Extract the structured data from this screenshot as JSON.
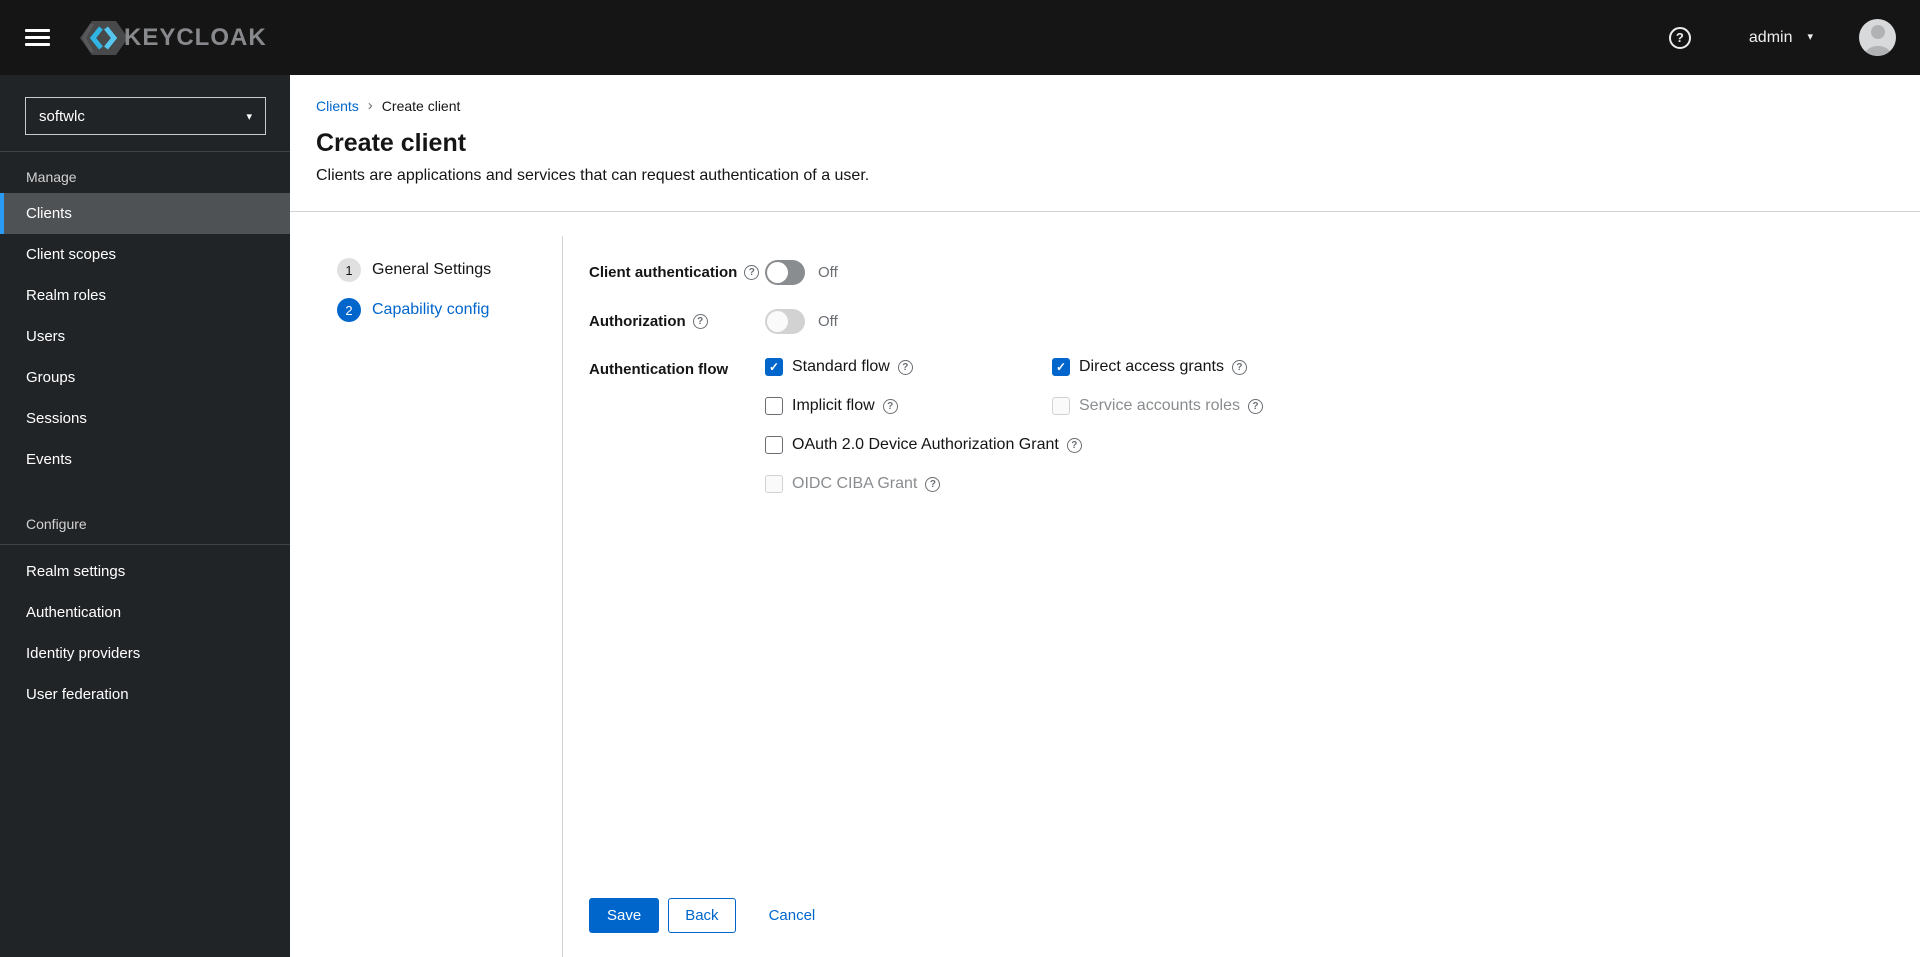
{
  "masthead": {
    "brand_text": "KEYCLOAK",
    "user_name": "admin"
  },
  "icons": {
    "help_glyph": "?",
    "caret_glyph": "▾",
    "check_glyph": "✓",
    "breadcrumb_sep": "›"
  },
  "sidebar": {
    "realm_selector": {
      "value": "softwlc"
    },
    "sections": [
      {
        "title": "Manage",
        "items": [
          {
            "label": "Clients",
            "current": true
          },
          {
            "label": "Client scopes",
            "current": false
          },
          {
            "label": "Realm roles",
            "current": false
          },
          {
            "label": "Users",
            "current": false
          },
          {
            "label": "Groups",
            "current": false
          },
          {
            "label": "Sessions",
            "current": false
          },
          {
            "label": "Events",
            "current": false
          }
        ]
      },
      {
        "title": "Configure",
        "items": [
          {
            "label": "Realm settings",
            "current": false
          },
          {
            "label": "Authentication",
            "current": false
          },
          {
            "label": "Identity providers",
            "current": false
          },
          {
            "label": "User federation",
            "current": false
          }
        ]
      }
    ]
  },
  "breadcrumb": {
    "items": [
      "Clients",
      "Create client"
    ]
  },
  "page": {
    "title": "Create client",
    "description": "Clients are applications and services that can request authentication of a user."
  },
  "wizard": {
    "steps": [
      {
        "number": "1",
        "label": "General Settings",
        "current": false
      },
      {
        "number": "2",
        "label": "Capability config",
        "current": true
      }
    ]
  },
  "form": {
    "client_authentication": {
      "label": "Client authentication",
      "state": "Off",
      "disabled": false
    },
    "authorization": {
      "label": "Authorization",
      "state": "Off",
      "disabled": true
    },
    "authentication_flow": {
      "label": "Authentication flow",
      "options": [
        {
          "label": "Standard flow",
          "checked": true,
          "disabled": false
        },
        {
          "label": "Direct access grants",
          "checked": true,
          "disabled": false
        },
        {
          "label": "Implicit flow",
          "checked": false,
          "disabled": false
        },
        {
          "label": "Service accounts roles",
          "checked": false,
          "disabled": true
        },
        {
          "label": "OAuth 2.0 Device Authorization Grant",
          "checked": false,
          "disabled": false
        },
        {
          "label": "OIDC CIBA Grant",
          "checked": false,
          "disabled": true
        }
      ]
    },
    "actions": {
      "save": "Save",
      "back": "Back",
      "cancel": "Cancel"
    }
  },
  "colors": {
    "masthead_bg": "#151515",
    "sidebar_bg": "#212427",
    "nav_current_bg": "#4f5255",
    "nav_current_indicator": "#2b9af3",
    "primary_blue": "#0066cc",
    "border_grey": "#d2d2d2",
    "muted_text": "#6a6e73",
    "disabled_text": "#8a8d90",
    "logo_cyan": "#2fb4e5"
  }
}
